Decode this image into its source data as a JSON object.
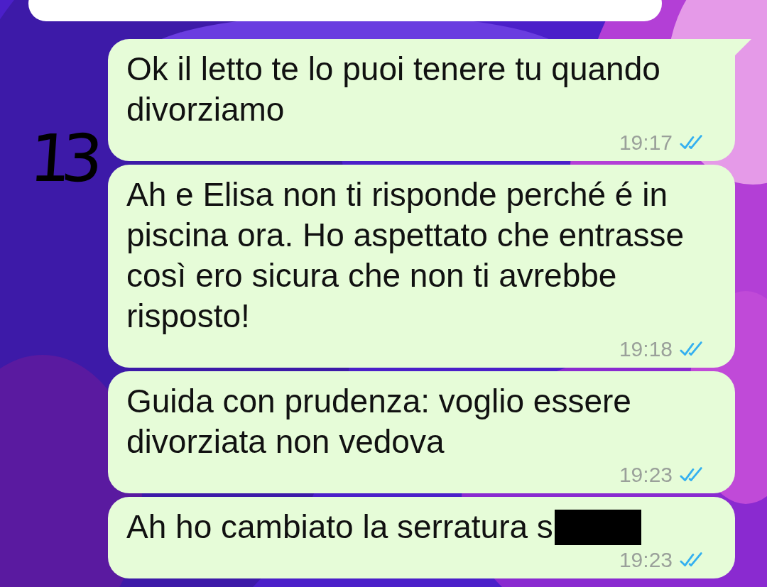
{
  "annotation": "13",
  "messages": [
    {
      "kind": "incoming"
    },
    {
      "kind": "outgoing",
      "text": "Ok il letto te lo puoi tenere tu quando divorziamo",
      "time": "19:17",
      "read": true,
      "tail": true
    },
    {
      "kind": "outgoing",
      "text": "Ah e Elisa non ti risponde perché é in piscina ora. Ho aspettato che entrasse così ero sicura che non ti avrebbe risposto!",
      "time": "19:18",
      "read": true,
      "tail": false
    },
    {
      "kind": "outgoing",
      "text": "Guida con prudenza: voglio essere divorziata non vedova",
      "time": "19:23",
      "read": true,
      "tail": false
    },
    {
      "kind": "outgoing",
      "text": "Ah ho cambiato la serratura s",
      "redacted": true,
      "time": "19:23",
      "read": true,
      "tail": false
    }
  ]
}
